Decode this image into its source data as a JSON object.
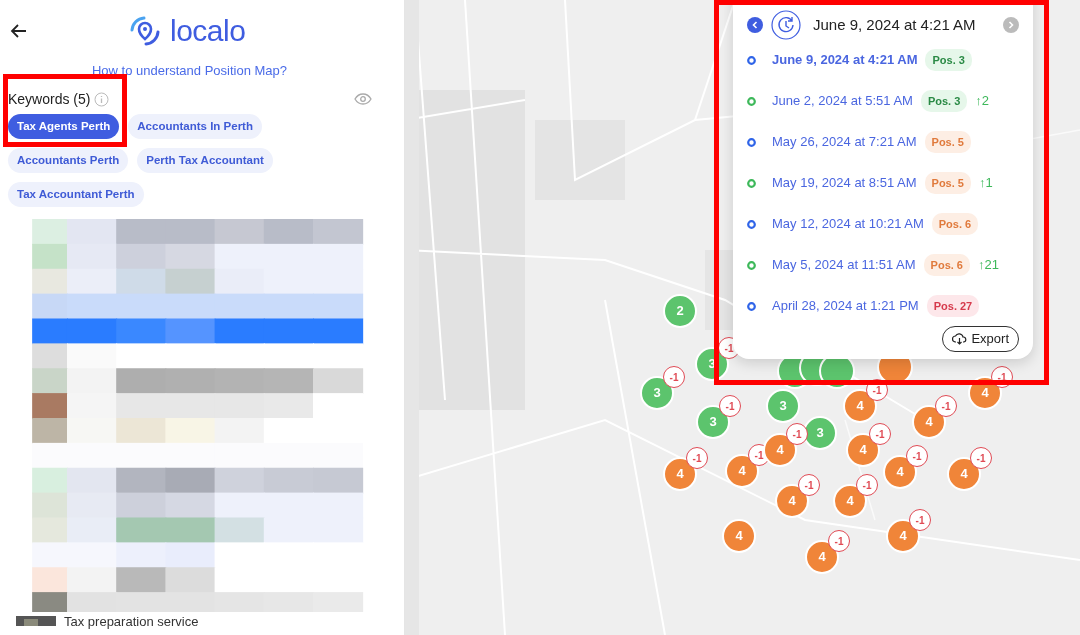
{
  "header": {
    "logo": "localo"
  },
  "help_link": "How to understand Position Map?",
  "keywords": {
    "title": "Keywords (5)",
    "items": [
      {
        "label": "Tax Agents Perth",
        "selected": true
      },
      {
        "label": "Accountants In Perth",
        "selected": false
      },
      {
        "label": "Accountants Perth",
        "selected": false
      },
      {
        "label": "Perth Tax Accountant",
        "selected": false
      },
      {
        "label": "Tax Accountant Perth",
        "selected": false
      }
    ]
  },
  "results": {
    "kind": "picture",
    "partial_item": "Tax preparation service"
  },
  "map": {
    "markers": [
      {
        "rank": "2",
        "kind": "green"
      },
      {
        "rank": "3",
        "kind": "green",
        "change": "-1"
      },
      {
        "rank": "3",
        "kind": "green",
        "change": "-1"
      },
      {
        "rank": "3",
        "kind": "green",
        "change": "-1"
      },
      {
        "rank": "3",
        "kind": "green"
      },
      {
        "rank": "3",
        "kind": "green"
      },
      {
        "rank": "4",
        "kind": "orange",
        "change": "-1"
      },
      {
        "rank": "4",
        "kind": "orange",
        "change": "-1"
      },
      {
        "rank": "4",
        "kind": "orange",
        "change": "-1"
      },
      {
        "rank": "4",
        "kind": "orange",
        "change": "-1"
      },
      {
        "rank": "4",
        "kind": "orange",
        "change": "-1"
      },
      {
        "rank": "4",
        "kind": "orange",
        "change": "-1"
      },
      {
        "rank": "4",
        "kind": "orange",
        "change": "-1"
      },
      {
        "rank": "4",
        "kind": "orange",
        "change": "-1"
      },
      {
        "rank": "4",
        "kind": "orange",
        "change": "-1"
      },
      {
        "rank": "4",
        "kind": "orange",
        "change": "-1"
      },
      {
        "rank": "4",
        "kind": "orange",
        "change": "-1"
      },
      {
        "rank": "4",
        "kind": "orange"
      },
      {
        "rank": "4",
        "kind": "orange",
        "change": "-1"
      },
      {
        "rank": "4",
        "kind": "orange",
        "change": "-1"
      }
    ]
  },
  "history": {
    "current": "June 9, 2024 at 4:21 AM",
    "entries": [
      {
        "date": "June 9, 2024 at 4:21 AM",
        "selected": true,
        "color": "#2f64e8",
        "position": "Pos. 3",
        "kind": "green"
      },
      {
        "date": "June 2, 2024 at 5:51 AM",
        "selected": false,
        "color": "#3db85a",
        "position": "Pos. 3",
        "kind": "green",
        "change": "↑2"
      },
      {
        "date": "May 26, 2024 at 7:21 AM",
        "selected": false,
        "color": "#2f64e8",
        "position": "Pos. 5",
        "kind": "orange"
      },
      {
        "date": "May 19, 2024 at 8:51 AM",
        "selected": false,
        "color": "#3db85a",
        "position": "Pos. 5",
        "kind": "orange",
        "change": "↑1"
      },
      {
        "date": "May 12, 2024 at 10:21 AM",
        "selected": false,
        "color": "#2f64e8",
        "position": "Pos. 6",
        "kind": "orange"
      },
      {
        "date": "May 5, 2024 at 11:51 AM",
        "selected": false,
        "color": "#3db85a",
        "position": "Pos. 6",
        "kind": "orange",
        "change": "↑21"
      },
      {
        "date": "April 28, 2024 at 1:21 PM",
        "selected": false,
        "color": "#2f64e8",
        "position": "Pos. 27",
        "kind": "red"
      }
    ],
    "export": "Export"
  }
}
